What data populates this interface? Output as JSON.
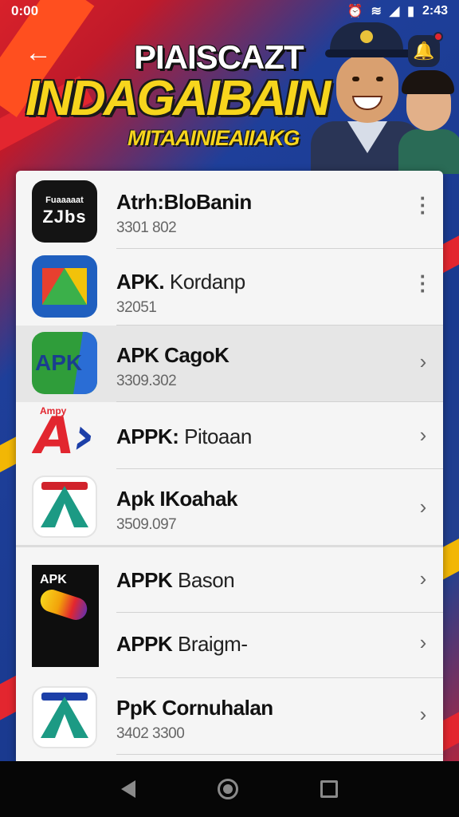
{
  "status_bar": {
    "left_text": "0:00",
    "time": "2:43",
    "icons": [
      "alarm-icon",
      "wifi-icon",
      "signal-icon",
      "battery-icon"
    ]
  },
  "header": {
    "title_line_1": "PIAISCAZT",
    "title_line_2": "INDAGAIBAIN",
    "title_line_3": "MITAAINIEAIIAKG",
    "back_icon": "back-arrow-icon",
    "notification_icon": "bell-icon"
  },
  "list": {
    "items": [
      {
        "title_bold": "Atrh:BloBanin",
        "title_rest": "",
        "subtitle": "3301 802",
        "icon_text": "Fuaaaaat",
        "icon_text_2": "ZJbs",
        "action": "more-vert-icon"
      },
      {
        "title_bold": "APK.",
        "title_rest": " Kordanp",
        "subtitle": "32051",
        "action": "more-vert-icon"
      },
      {
        "title_bold": "APK CagoK",
        "title_rest": "",
        "subtitle": "3309.302",
        "icon_text": "APK",
        "action": "chevron-right-icon"
      },
      {
        "title_bold": "APPK:",
        "title_rest": " Pitoaan",
        "subtitle": "",
        "icon_text": "Ampy",
        "action": "chevron-right-icon"
      },
      {
        "title_bold": "Apk IKoahak",
        "title_rest": "",
        "subtitle": "3509.097",
        "action": "chevron-right-icon"
      },
      {
        "title_bold": "APPK",
        "title_rest": " Bason",
        "subtitle": "",
        "icon_text": "APK",
        "action": "chevron-right-icon"
      },
      {
        "title_bold": "APPK",
        "title_rest": " Braigm-",
        "subtitle": "",
        "action": "chevron-right-icon"
      },
      {
        "title_bold": "PpK Cornuhalan",
        "title_rest": "",
        "subtitle": "3402 3300",
        "action": "chevron-right-icon"
      }
    ]
  },
  "nav_bar": {
    "icons": [
      "nav-back-icon",
      "nav-home-icon",
      "nav-recents-icon"
    ]
  },
  "colors": {
    "accent_red": "#e2262f",
    "accent_yellow": "#f7d51d",
    "header_blue": "#1e3f9a",
    "card_bg": "#f5f5f5"
  }
}
